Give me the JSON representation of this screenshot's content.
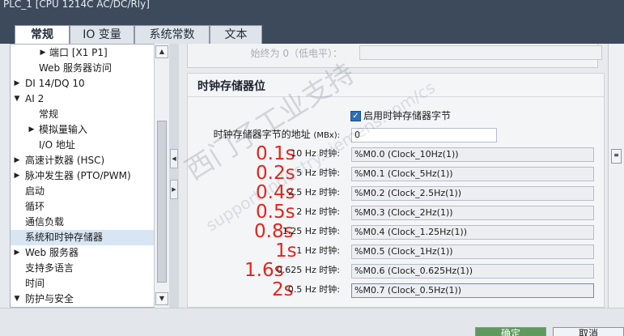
{
  "window": {
    "title": "PLC_1 [CPU 1214C AC/DC/Rly]"
  },
  "tabs": [
    {
      "label": "常规",
      "active": true
    },
    {
      "label": "IO 变量",
      "active": false
    },
    {
      "label": "系统常数",
      "active": false
    },
    {
      "label": "文本",
      "active": false
    }
  ],
  "nav": {
    "items": [
      {
        "label": "端口 [X1 P1]",
        "arrow": "right",
        "indent": 2
      },
      {
        "label": "Web 服务器访问",
        "arrow": "",
        "indent": 2
      },
      {
        "label": "DI 14/DQ 10",
        "arrow": "right",
        "indent": 0
      },
      {
        "label": "AI 2",
        "arrow": "down",
        "indent": 0
      },
      {
        "label": "常规",
        "arrow": "",
        "indent": 1
      },
      {
        "label": "模拟量输入",
        "arrow": "right",
        "indent": 1
      },
      {
        "label": "I/O 地址",
        "arrow": "",
        "indent": 1
      },
      {
        "label": "高速计数器 (HSC)",
        "arrow": "right",
        "indent": 0
      },
      {
        "label": "脉冲发生器 (PTO/PWM)",
        "arrow": "right",
        "indent": 0
      },
      {
        "label": "启动",
        "arrow": "",
        "indent": 0
      },
      {
        "label": "循环",
        "arrow": "",
        "indent": 0
      },
      {
        "label": "通信负载",
        "arrow": "",
        "indent": 0
      },
      {
        "label": "系统和时钟存储器",
        "arrow": "",
        "indent": 0,
        "selected": true
      },
      {
        "label": "Web 服务器",
        "arrow": "right",
        "indent": 0
      },
      {
        "label": "支持多语言",
        "arrow": "",
        "indent": 0
      },
      {
        "label": "时间",
        "arrow": "",
        "indent": 0
      },
      {
        "label": "防护与安全",
        "arrow": "down",
        "indent": 0
      }
    ]
  },
  "top": {
    "label": "始终为 0（低电平）：",
    "value": ""
  },
  "clock_section": {
    "title": "时钟存储器位",
    "enable_label": "启用时钟存储器字节",
    "enable_checked": true,
    "address_label": "时钟存储器字节的地址",
    "address_unit": "(MBx):",
    "address_value": "0",
    "rows": [
      {
        "label": "10 Hz 时钟:",
        "value": "%M0.0 (Clock_10Hz(1))",
        "annotation": "0.1s"
      },
      {
        "label": "5 Hz 时钟:",
        "value": "%M0.1 (Clock_5Hz(1))",
        "annotation": "0.2s"
      },
      {
        "label": "2.5 Hz 时钟:",
        "value": "%M0.2 (Clock_2.5Hz(1))",
        "annotation": "0.4s"
      },
      {
        "label": "2 Hz 时钟:",
        "value": "%M0.3 (Clock_2Hz(1))",
        "annotation": "0.5s"
      },
      {
        "label": "1.25 Hz 时钟:",
        "value": "%M0.4 (Clock_1.25Hz(1))",
        "annotation": "0.8s"
      },
      {
        "label": "1 Hz 时钟:",
        "value": "%M0.5 (Clock_1Hz(1))",
        "annotation": "1s"
      },
      {
        "label": "0.625 Hz 时钟:",
        "value": "%M0.6 (Clock_0.625Hz(1))",
        "annotation": "1.6s"
      },
      {
        "label": "0.5 Hz 时钟:",
        "value": "%M0.7 (Clock_0.5Hz(1))",
        "annotation": "2s"
      }
    ]
  },
  "footer": {
    "ok_label": "确定",
    "cancel_label": "取消"
  },
  "watermark": {
    "line1": "西门子工业支持",
    "line2": "support.industry.siemens.com/cs"
  },
  "colors": {
    "annotation": "#e0251c",
    "ok_button": "#5e9a5c",
    "title_bar": "#3c4a5c"
  }
}
